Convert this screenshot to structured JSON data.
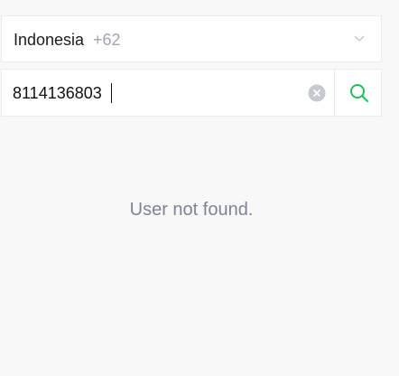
{
  "country_select": {
    "country_name": "Indonesia",
    "dial_code": "+62",
    "icon": "chevron-down-icon"
  },
  "search": {
    "phone_value": "8114136803",
    "clear_icon": "clear-icon",
    "search_icon": "search-icon"
  },
  "result": {
    "message": "User not found."
  },
  "colors": {
    "accent": "#1ec25a",
    "background": "#f8f8f8",
    "muted_text": "#7d8493"
  }
}
